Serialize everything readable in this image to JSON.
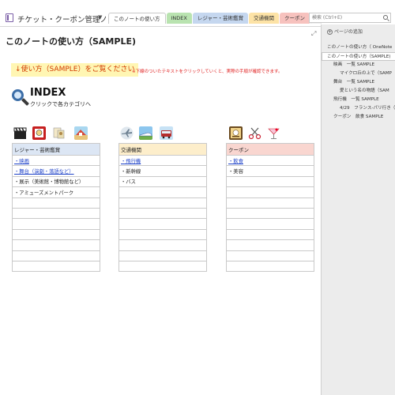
{
  "notebook": {
    "title": "チケット・クーポン管理ノート"
  },
  "tabs": [
    {
      "label": "このノートの使い方",
      "color": "#ffffff"
    },
    {
      "label": "INDEX",
      "color": "#b9e3b0"
    },
    {
      "label": "レジャー・芸術鑑賞",
      "color": "#c5d7ef"
    },
    {
      "label": "交通機関",
      "color": "#fde3a6"
    },
    {
      "label": "クーポン",
      "color": "#f7c2be"
    }
  ],
  "tab_add": "+",
  "search": {
    "placeholder": "検索 (Ctrl+E)"
  },
  "page": {
    "title": "このノートの使い方（SAMPLE)",
    "banner": "↓使い方（SAMPLE）をご覧ください",
    "banner_note": "※下線のついたテキストをクリックしていくと、実際の手順が確認できます。",
    "index_title": "INDEX",
    "index_sub": "クリックで各カテゴリへ"
  },
  "categories": [
    {
      "header": "レジャー・芸術鑑賞",
      "header_color": "#dce6f4",
      "rows": [
        {
          "text": "・映画",
          "link": true
        },
        {
          "text": "・舞台（演劇・落語など）",
          "link": true
        },
        {
          "text": "・展示（美術館・博物館など）",
          "link": false
        },
        {
          "text": "・アミューズメントパーク",
          "link": false
        },
        {
          "text": ""
        },
        {
          "text": ""
        },
        {
          "text": ""
        },
        {
          "text": ""
        },
        {
          "text": ""
        },
        {
          "text": ""
        },
        {
          "text": ""
        }
      ]
    },
    {
      "header": "交通機関",
      "header_color": "#fdeecb",
      "rows": [
        {
          "text": "・飛行機",
          "link": true
        },
        {
          "text": "・新幹線",
          "link": false
        },
        {
          "text": "・バス",
          "link": false
        },
        {
          "text": ""
        },
        {
          "text": ""
        },
        {
          "text": ""
        },
        {
          "text": ""
        },
        {
          "text": ""
        },
        {
          "text": ""
        },
        {
          "text": ""
        },
        {
          "text": ""
        }
      ]
    },
    {
      "header": "クーポン",
      "header_color": "#f9d6d0",
      "rows": [
        {
          "text": "・飲食",
          "link": true
        },
        {
          "text": "・美容",
          "link": false
        },
        {
          "text": ""
        },
        {
          "text": ""
        },
        {
          "text": ""
        },
        {
          "text": ""
        },
        {
          "text": ""
        },
        {
          "text": ""
        },
        {
          "text": ""
        },
        {
          "text": ""
        },
        {
          "text": ""
        }
      ]
    }
  ],
  "category_icons": [
    [
      "clapperboard-icon",
      "theater-mask-icon",
      "museum-icon",
      "amusement-park-icon"
    ],
    [
      "airplane-icon",
      "bullet-train-icon",
      "bus-icon"
    ],
    [
      "food-coupon-icon",
      "scissors-icon",
      "cocktail-icon"
    ]
  ],
  "sidebar": {
    "add_page": "ページの追加",
    "pages": [
      {
        "label": "このノートの使い方（ OneNote",
        "indent": 0,
        "selected": false
      },
      {
        "label": "このノートの使い方（SAMPLE)",
        "indent": 0,
        "selected": true
      },
      {
        "label": "映画　一覧 SAMPLE",
        "indent": 1,
        "selected": false
      },
      {
        "label": "マイクロ丘の上で（SAMP",
        "indent": 2,
        "selected": false
      },
      {
        "label": "舞台　一覧 SAMPLE",
        "indent": 1,
        "selected": false
      },
      {
        "label": "愛という名の物語（SAM",
        "indent": 2,
        "selected": false
      },
      {
        "label": "飛行機　一覧 SAMPLE",
        "indent": 1,
        "selected": false
      },
      {
        "label": "4/29　フランス-パリ行き（",
        "indent": 2,
        "selected": false
      },
      {
        "label": "クーポン　飲食 SAMPLE",
        "indent": 1,
        "selected": false
      }
    ]
  }
}
